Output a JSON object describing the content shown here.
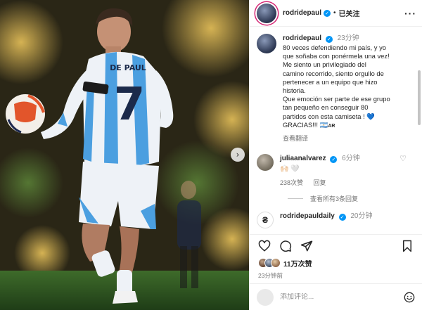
{
  "post": {
    "author": "rodridepaul",
    "follow_state": "已关注",
    "more_icon": "more-horizontal-icon"
  },
  "caption": {
    "author": "rodridepaul",
    "time": "23分钟",
    "text": "80 veces defendiendo mi país, y yo\nque soñaba con ponérmela una vez!\nMe siento un privilegiado del\ncamino recorrido, siento orgullo de\npertenecer a un equipo que hizo\nhistoria.\nQue emoción ser parte de ese grupo\ntan pequeño en conseguir 80\npartidos con esta camiseta !",
    "heart": "💙",
    "last_line": "GRACIAS!!!",
    "flag_code": "AR",
    "translate_link": "查看翻译"
  },
  "comments": [
    {
      "author": "juliaanalvarez",
      "time": "6分钟",
      "likes": "238次赞",
      "reply": "回复"
    }
  ],
  "view_replies": "查看所有3条回复",
  "partial_comment": {
    "author": "rodridepauldaily",
    "time": "20分钟"
  },
  "likes_count": "11万次赞",
  "posted_time": "23分钟前",
  "comment_placeholder": "添加评论...",
  "jersey": {
    "name": "DE PAUL",
    "number": "7"
  },
  "colors": {
    "accent": "#0095f6",
    "story_ring": "#d62976",
    "jersey_blue": "#4b9fe0"
  }
}
